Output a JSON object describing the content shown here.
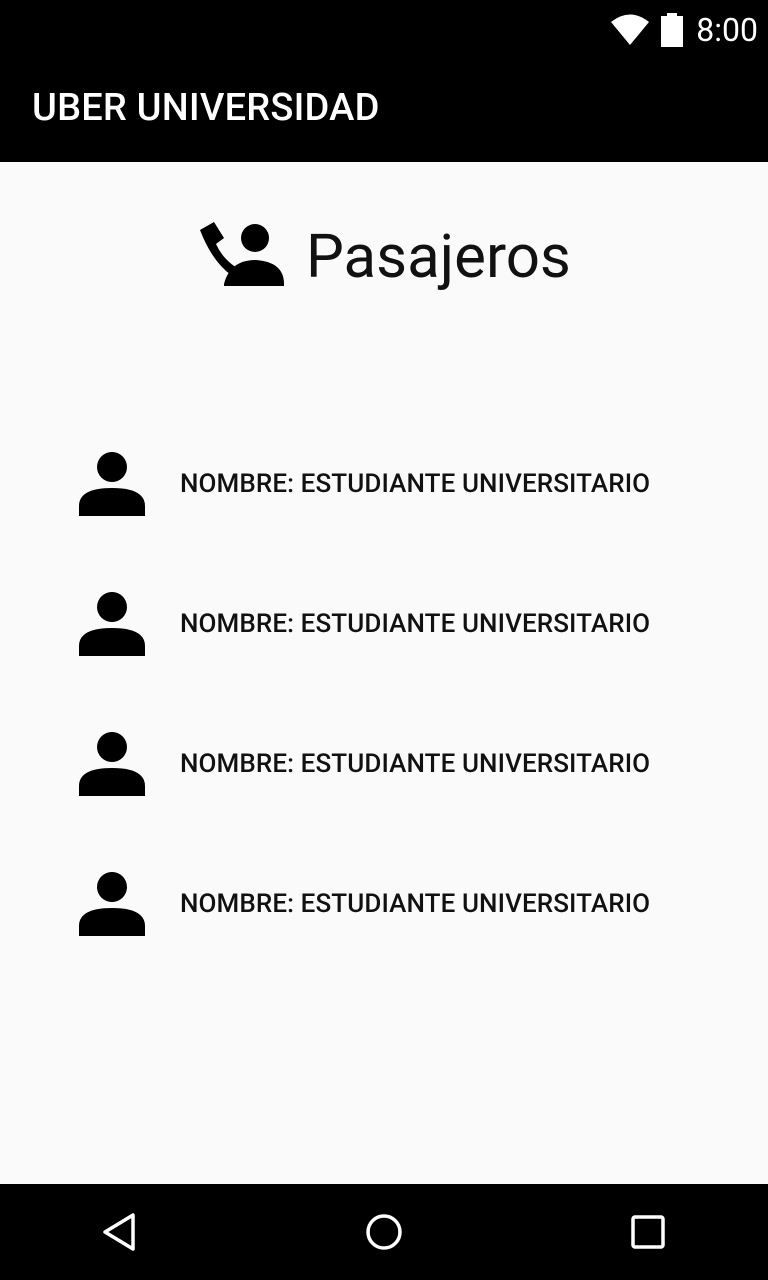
{
  "status_bar": {
    "time": "8:00",
    "icons": [
      "wifi-icon",
      "battery-icon"
    ]
  },
  "app_bar": {
    "title": "UBER UNIVERSIDAD"
  },
  "header": {
    "icon": "passenger-icon",
    "title": "Pasajeros"
  },
  "passengers": [
    {
      "icon": "person-icon",
      "label": "NOMBRE: ESTUDIANTE UNIVERSITARIO"
    },
    {
      "icon": "person-icon",
      "label": "NOMBRE: ESTUDIANTE UNIVERSITARIO"
    },
    {
      "icon": "person-icon",
      "label": "NOMBRE: ESTUDIANTE UNIVERSITARIO"
    },
    {
      "icon": "person-icon",
      "label": "NOMBRE: ESTUDIANTE UNIVERSITARIO"
    }
  ],
  "nav_bar": {
    "buttons": [
      "back-icon",
      "home-icon",
      "recents-icon"
    ]
  },
  "colors": {
    "bar_background": "#000000",
    "content_background": "#fafafa",
    "text": "#111111",
    "icon": "#000000"
  }
}
